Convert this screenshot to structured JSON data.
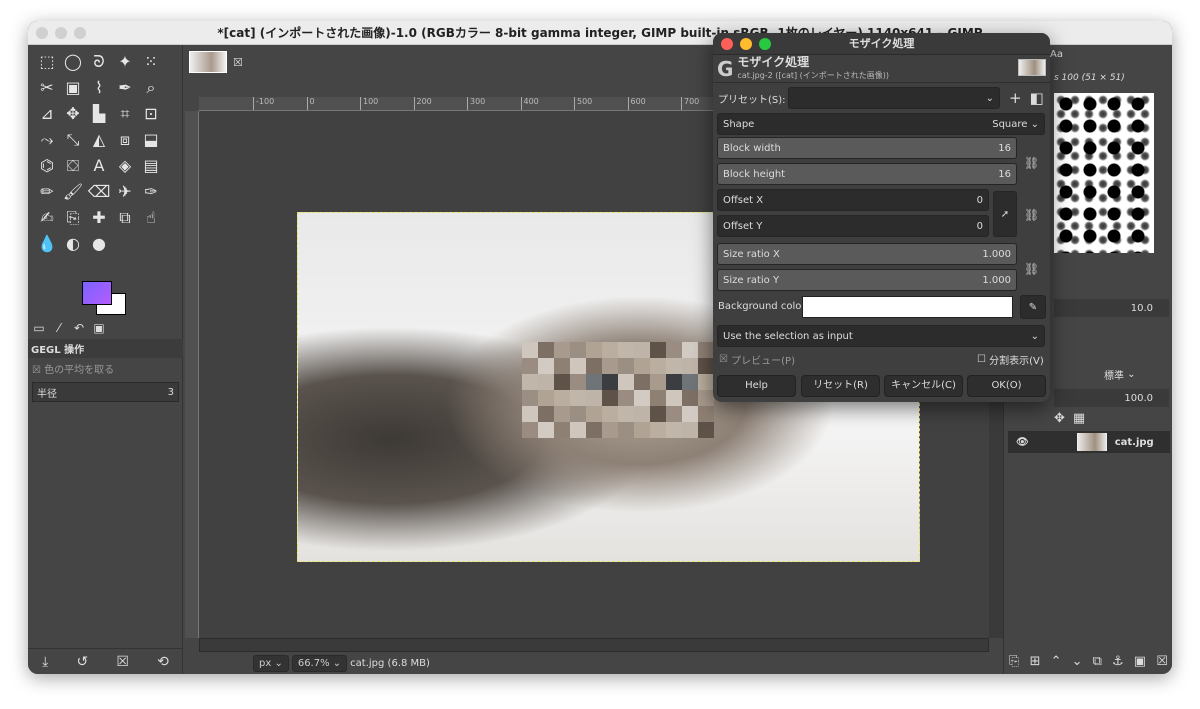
{
  "window": {
    "title": "*[cat] (インポートされた画像)-1.0 (RGBカラー 8-bit gamma integer, GIMP built-in sRGB, 1枚のレイヤー) 1140x641 – GIMP"
  },
  "toolbox": {
    "tools": [
      "rect-select",
      "ellipse-select",
      "free-select",
      "fuzzy-select",
      "by-color-select",
      "scissors",
      "foreground-select",
      "paths",
      "color-picker",
      "zoom",
      "measure",
      "move",
      "align",
      "crop",
      "unified-transform",
      "warp-transform",
      "handle-transform",
      "perspective",
      "3d-transform",
      "flip",
      "cage",
      "bucket-fill",
      "text",
      "fill",
      "blend",
      "pencil",
      "paintbrush",
      "eraser",
      "airbrush",
      "ink",
      "mypaint",
      "clone",
      "heal",
      "perspective-clone",
      "smudge",
      "blur",
      "dodge",
      "burn"
    ],
    "tabs": [
      "tool-options",
      "brushes",
      "undo",
      "images"
    ],
    "options": {
      "title": "GEGL 操作",
      "checkbox": "色の平均を取る",
      "radius_label": "半径",
      "radius_value": "3"
    }
  },
  "canvas": {
    "ruler_ticks": [
      "-100",
      "0",
      "100",
      "200",
      "300",
      "400",
      "500",
      "600",
      "700"
    ],
    "unit": "px",
    "zoom": "66.7%",
    "file_info": "cat.jpg (6.8 MB)",
    "mosaic_colors": [
      "#cfc7be",
      "#bfb4a8",
      "#a89a8c",
      "#9a8c80",
      "#b0a394",
      "#8e8073",
      "#c1b6aa",
      "#7d6f63",
      "#5e5249",
      "#9b8e82",
      "#d2cbc3",
      "#b9ae9f"
    ]
  },
  "right_panel": {
    "brush_label": "s 100 (51 × 51)",
    "spacing": "10.0",
    "mode": "標準",
    "opacity": "100.0",
    "layer": {
      "name": "cat.jpg"
    }
  },
  "dialog": {
    "title": "モザイク処理",
    "header": "モザイク処理",
    "subheader": "cat.jpg-2 ([cat] (インポートされた画像))",
    "preset_label": "プリセット(S):",
    "preset_value": "",
    "shape_label": "Shape",
    "shape_value": "Square",
    "block_width_label": "Block width",
    "block_width": "16",
    "block_height_label": "Block height",
    "block_height": "16",
    "offset_x_label": "Offset X",
    "offset_x": "0",
    "offset_y_label": "Offset Y",
    "offset_y": "0",
    "ratio_x_label": "Size ratio X",
    "ratio_x": "1.000",
    "ratio_y_label": "Size ratio Y",
    "ratio_y": "1.000",
    "bg_label": "Background color",
    "bg_color": "#ffffff",
    "input_value": "Use the selection as input",
    "preview_label": "プレビュー(P)",
    "split_label": "分割表示(V)",
    "buttons": {
      "help": "Help",
      "reset": "リセット(R)",
      "cancel": "キャンセル(C)",
      "ok": "OK(O)"
    }
  }
}
